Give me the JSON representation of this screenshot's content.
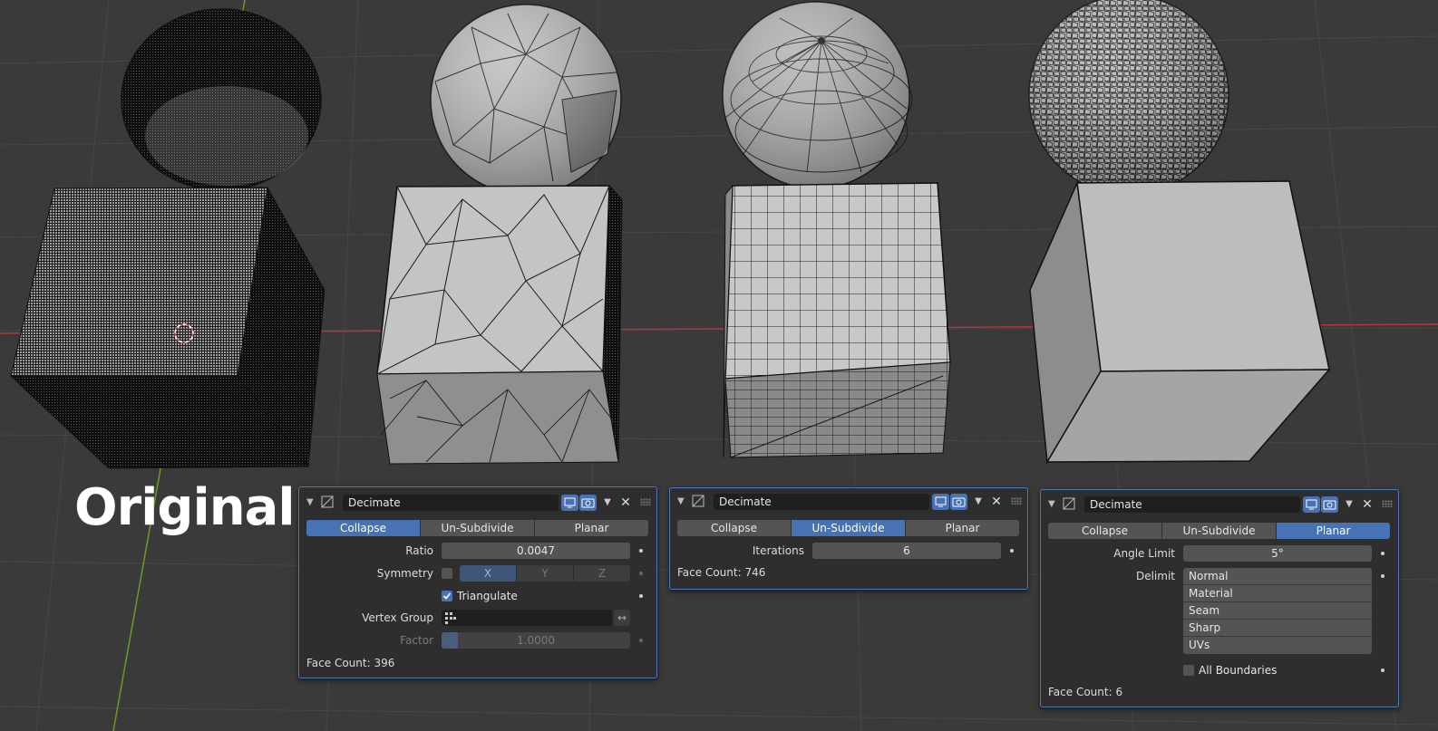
{
  "label_original": "Original",
  "modifier_panels": [
    {
      "name": "Decimate",
      "tabs": [
        "Collapse",
        "Un-Subdivide",
        "Planar"
      ],
      "active_tab": "Collapse",
      "ratio_label": "Ratio",
      "ratio_value": "0.0047",
      "symmetry_label": "Symmetry",
      "axes": [
        "X",
        "Y",
        "Z"
      ],
      "triangulate_label": "Triangulate",
      "vertex_group_label": "Vertex Group",
      "factor_label": "Factor",
      "factor_value": "1.0000",
      "face_count": "Face Count: 396"
    },
    {
      "name": "Decimate",
      "tabs": [
        "Collapse",
        "Un-Subdivide",
        "Planar"
      ],
      "active_tab": "Un-Subdivide",
      "iterations_label": "Iterations",
      "iterations_value": "6",
      "face_count": "Face Count: 746"
    },
    {
      "name": "Decimate",
      "tabs": [
        "Collapse",
        "Un-Subdivide",
        "Planar"
      ],
      "active_tab": "Planar",
      "angle_limit_label": "Angle Limit",
      "angle_limit_value": "5°",
      "delimit_label": "Delimit",
      "delimit_options": [
        "Normal",
        "Material",
        "Seam",
        "Sharp",
        "UVs"
      ],
      "all_boundaries_label": "All Boundaries",
      "face_count": "Face Count: 6"
    }
  ],
  "colors": {
    "accent": "#4772b3",
    "viewport_bg": "#3a3a3a",
    "grid_line": "#474747",
    "x_axis": "#b2373c",
    "y_axis": "#6c9a26",
    "panel_bg": "#2e2e2e",
    "mesh_light": "#b8b8b8",
    "mesh_mid": "#9a9a9a",
    "mesh_dark": "#2a2a2a"
  }
}
